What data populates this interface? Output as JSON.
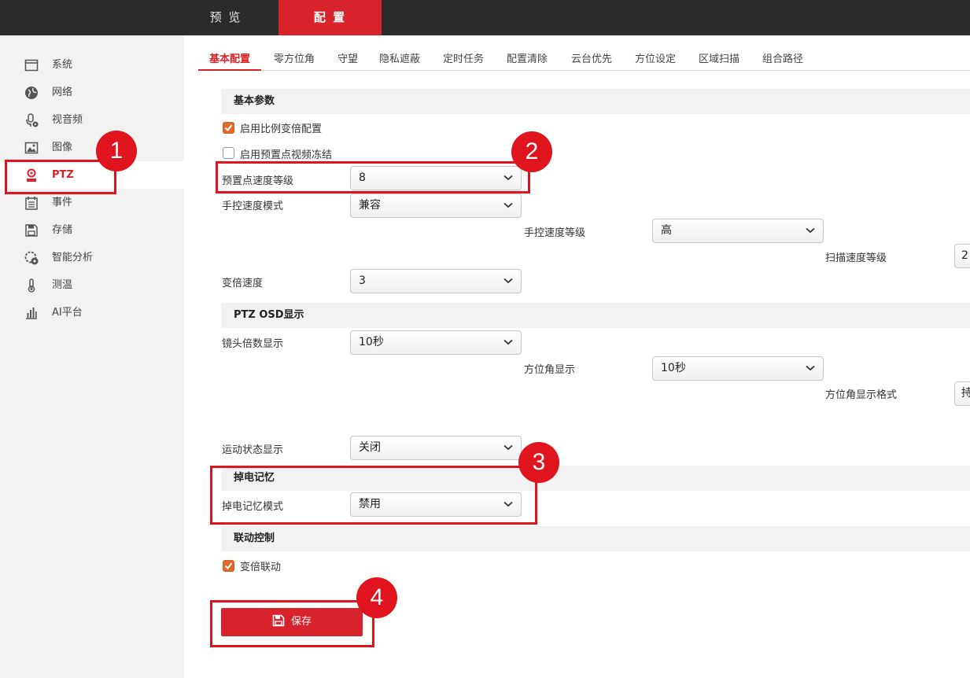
{
  "topnav": {
    "preview_label": "预 览",
    "config_label": "配 置"
  },
  "sidebar": {
    "items": [
      {
        "label": "系统",
        "icon": "monitor-icon"
      },
      {
        "label": "网络",
        "icon": "globe-icon"
      },
      {
        "label": "视音频",
        "icon": "microphone-camera-icon"
      },
      {
        "label": "图像",
        "icon": "image-icon"
      },
      {
        "label": "PTZ",
        "icon": "ptz-camera-icon",
        "active": true
      },
      {
        "label": "事件",
        "icon": "calendar-icon"
      },
      {
        "label": "存储",
        "icon": "floppy-disk-icon"
      },
      {
        "label": "智能分析",
        "icon": "smart-analysis-icon"
      },
      {
        "label": "测温",
        "icon": "thermometer-icon"
      },
      {
        "label": "AI平台",
        "icon": "bar-chart-icon"
      }
    ]
  },
  "subtabs": [
    {
      "label": "基本配置",
      "active": true
    },
    {
      "label": "零方位角"
    },
    {
      "label": "守望"
    },
    {
      "label": "隐私遮蔽"
    },
    {
      "label": "定时任务"
    },
    {
      "label": "配置清除"
    },
    {
      "label": "云台优先"
    },
    {
      "label": "方位设定"
    },
    {
      "label": "区域扫描"
    },
    {
      "label": "组合路径"
    }
  ],
  "basic": {
    "header": "基本参数",
    "enable_ratio_zoom": {
      "label": "启用比例变倍配置",
      "checked": true
    },
    "enable_preset_freeze": {
      "label": "启用预置点视频冻结",
      "checked": false
    },
    "preset_speed": {
      "label": "预置点速度等级",
      "value": "8"
    },
    "manual_speed_mode": {
      "label": "手控速度模式",
      "value": "兼容"
    },
    "manual_speed_level": {
      "label": "手控速度等级",
      "value": "高"
    },
    "scan_speed_level": {
      "label": "扫描速度等级",
      "value": "2"
    },
    "zoom_speed": {
      "label": "变倍速度",
      "value": "3"
    }
  },
  "osd": {
    "header": "PTZ OSD显示",
    "zoom_display": {
      "label": "镜头倍数显示",
      "value": "10秒"
    },
    "azimuth_display": {
      "label": "方位角显示",
      "value": "10秒"
    },
    "azimuth_format": {
      "label": "方位角显示格式",
      "value": "持"
    },
    "motion_status": {
      "label": "运动状态显示",
      "value": "关闭"
    }
  },
  "power_memory": {
    "header": "掉电记忆",
    "mode": {
      "label": "掉电记忆模式",
      "value": "禁用"
    }
  },
  "linkage": {
    "header": "联动控制",
    "zoom_linkage": {
      "label": "变倍联动",
      "checked": true
    }
  },
  "save_label": "保存",
  "annotations": [
    "1",
    "2",
    "3",
    "4"
  ],
  "colors": {
    "accent": "#d8232a",
    "annotation": "#e0141c",
    "checkbox_on": "#e06a2e",
    "topbar": "#2b2b2b",
    "sidebar": "#f2f2f2"
  }
}
